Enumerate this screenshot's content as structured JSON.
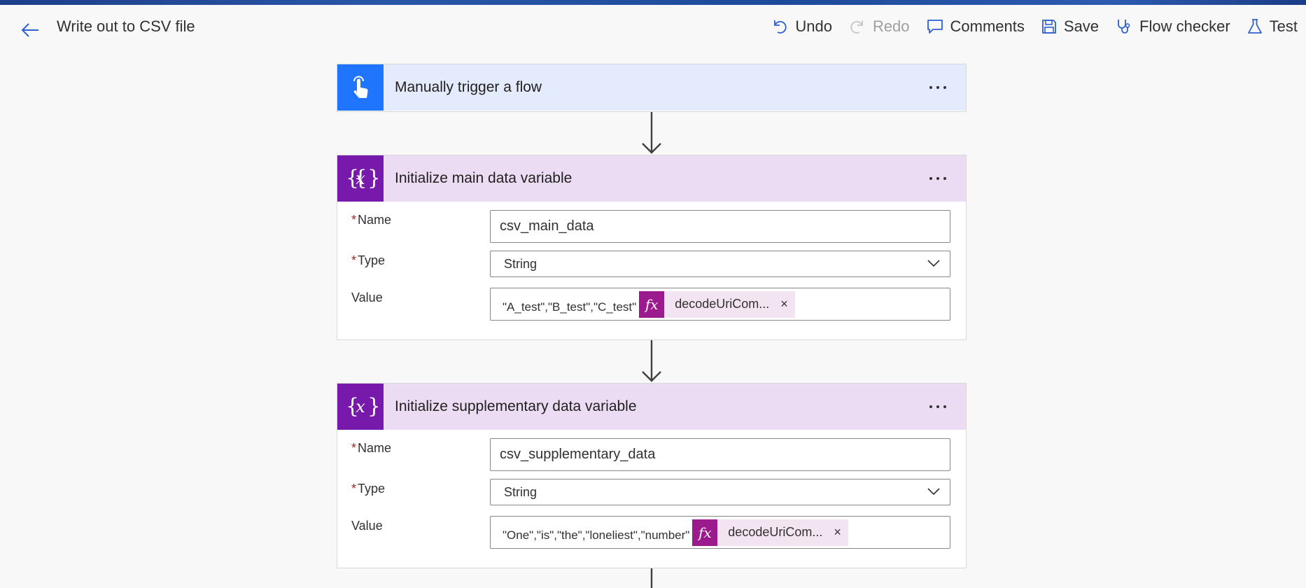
{
  "header": {
    "title": "Write out to CSV file",
    "toolbar": {
      "undo": "Undo",
      "redo": "Redo",
      "comments": "Comments",
      "save": "Save",
      "flow_checker": "Flow checker",
      "test": "Test"
    }
  },
  "colors": {
    "trigger_header": "#e3ebfc",
    "trigger_icon": "#1f75fe",
    "variable_header": "#ebdcf4",
    "variable_icon": "#7719aa",
    "fx_badge": "#9b1a8e"
  },
  "steps": [
    {
      "title": "Manually trigger a flow",
      "icon": "touch-hand-icon"
    },
    {
      "title": "Initialize main data variable",
      "icon": "variable-icon",
      "labels": {
        "name": "Name",
        "type": "Type",
        "value": "Value"
      },
      "name_value": "csv_main_data",
      "type_value": "String",
      "value_text": "\"A_test\",\"B_test\",\"C_test\"",
      "expression_label": "decodeUriCom...",
      "fx": "fx",
      "required_mark": "*",
      "close": "×"
    },
    {
      "title": "Initialize supplementary data variable",
      "icon": "variable-icon",
      "labels": {
        "name": "Name",
        "type": "Type",
        "value": "Value"
      },
      "name_value": "csv_supplementary_data",
      "type_value": "String",
      "value_text": "\"One\",\"is\",\"the\",\"loneliest\",\"number\"",
      "expression_label": "decodeUriCom...",
      "fx": "fx",
      "required_mark": "*",
      "close": "×"
    }
  ]
}
